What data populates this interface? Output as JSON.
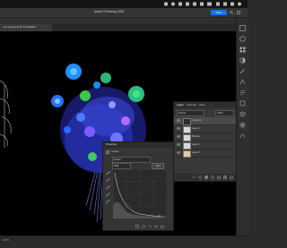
{
  "window": {
    "title": "Adobe Photoshop 2020"
  },
  "topbar": {
    "share_label": "Share"
  },
  "document": {
    "tab_title": "...de reno.psd @ 66.7% (RGB/8)",
    "zoom": "66.7%"
  },
  "layers_panel": {
    "tabs": [
      "Layers",
      "Channels",
      "Paths"
    ],
    "blend_mode": "Normal",
    "opacity": "100%",
    "layers": [
      {
        "name": "Curves 1",
        "thumb": "adjustment"
      },
      {
        "name": "Layer 2",
        "thumb": "white"
      },
      {
        "name": "Flowers",
        "thumb": "white"
      },
      {
        "name": "Layer 1",
        "thumb": "white"
      },
      {
        "name": "Layer 0",
        "thumb": "skin"
      }
    ]
  },
  "properties_panel": {
    "title": "Properties",
    "section": "Curves",
    "preset": "Default",
    "channel": "RGB",
    "auto_label": "Auto"
  },
  "colors": {
    "accent": "#1473e6",
    "canvas": "#000000",
    "panel": "#383838"
  }
}
